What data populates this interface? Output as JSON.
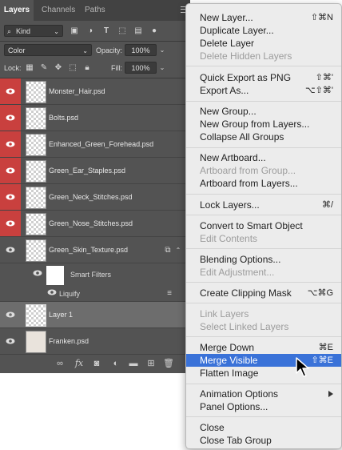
{
  "tabs": [
    "Layers",
    "Channels",
    "Paths"
  ],
  "filter": {
    "label": "Kind"
  },
  "blend": {
    "mode": "Color",
    "opacity_label": "Opacity:",
    "opacity_value": "100%"
  },
  "lock": {
    "label": "Lock:",
    "fill_label": "Fill:",
    "fill_value": "100%"
  },
  "layers": [
    {
      "name": "Monster_Hair.psd"
    },
    {
      "name": "Bolts.psd"
    },
    {
      "name": "Enhanced_Green_Forehead.psd"
    },
    {
      "name": "Green_Ear_Staples.psd"
    },
    {
      "name": "Green_Neck_Stitches.psd"
    },
    {
      "name": "Green_Nose_Stitches.psd"
    },
    {
      "name": "Green_Skin_Texture.psd"
    },
    {
      "name": "Layer 1"
    },
    {
      "name": "Franken.psd"
    }
  ],
  "smart_filters": {
    "label": "Smart Filters",
    "filter_name": "Liquify"
  },
  "menu": {
    "items": [
      {
        "label": "New Layer...",
        "shortcut": "⇧⌘N"
      },
      {
        "label": "Duplicate Layer...",
        "shortcut": ""
      },
      {
        "label": "Delete Layer",
        "shortcut": ""
      },
      {
        "label": "Delete Hidden Layers",
        "shortcut": ""
      },
      {
        "label": "Quick Export as PNG",
        "shortcut": "⇧⌘'"
      },
      {
        "label": "Export As...",
        "shortcut": "⌥⇧⌘'"
      },
      {
        "label": "New Group...",
        "shortcut": ""
      },
      {
        "label": "New Group from Layers...",
        "shortcut": ""
      },
      {
        "label": "Collapse All Groups",
        "shortcut": ""
      },
      {
        "label": "New Artboard...",
        "shortcut": ""
      },
      {
        "label": "Artboard from Group...",
        "shortcut": ""
      },
      {
        "label": "Artboard from Layers...",
        "shortcut": ""
      },
      {
        "label": "Lock Layers...",
        "shortcut": "⌘/"
      },
      {
        "label": "Convert to Smart Object",
        "shortcut": ""
      },
      {
        "label": "Edit Contents",
        "shortcut": ""
      },
      {
        "label": "Blending Options...",
        "shortcut": ""
      },
      {
        "label": "Edit Adjustment...",
        "shortcut": ""
      },
      {
        "label": "Create Clipping Mask",
        "shortcut": "⌥⌘G"
      },
      {
        "label": "Link Layers",
        "shortcut": ""
      },
      {
        "label": "Select Linked Layers",
        "shortcut": ""
      },
      {
        "label": "Merge Down",
        "shortcut": "⌘E"
      },
      {
        "label": "Merge Visible",
        "shortcut": "⇧⌘E"
      },
      {
        "label": "Flatten Image",
        "shortcut": ""
      },
      {
        "label": "Animation Options",
        "shortcut": ""
      },
      {
        "label": "Panel Options...",
        "shortcut": ""
      },
      {
        "label": "Close",
        "shortcut": ""
      },
      {
        "label": "Close Tab Group",
        "shortcut": ""
      }
    ]
  },
  "colors": {
    "visibility_red": "#c9403e",
    "menu_highlight": "#3a72d8",
    "panel_bg": "#535353"
  }
}
